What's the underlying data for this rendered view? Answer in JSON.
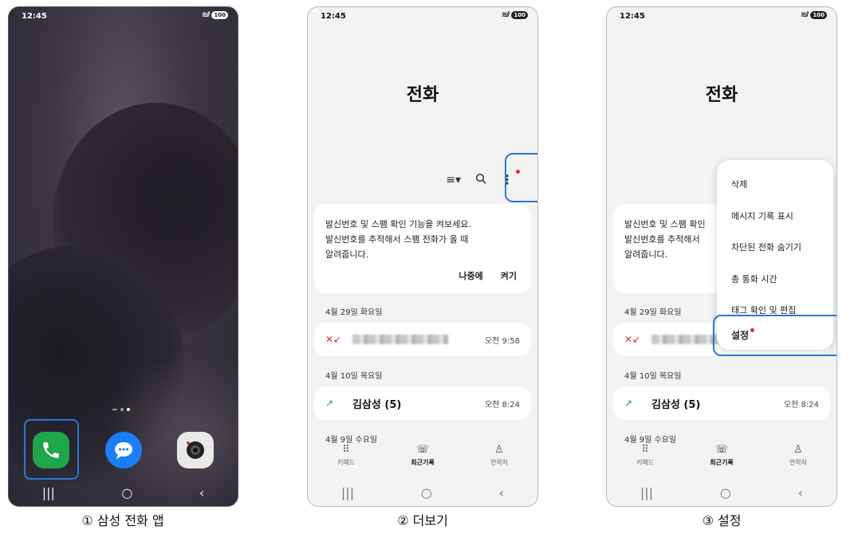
{
  "status": {
    "time": "12:45",
    "battery": "100"
  },
  "phone1": {
    "caption": "① 삼성 전화 앱"
  },
  "phone2": {
    "caption": "② 더보기",
    "title": "전화",
    "promo": {
      "line1": "발신번호 및 스팸 확인 기능을 켜보세요.",
      "line2": "발신번호를 추적해서 스팸 전화가 올 때",
      "line3": "알려줍니다.",
      "later": "나중에",
      "enable": "켜기"
    },
    "section1_date": "4월 29일 화요일",
    "call1_time": "오전 9:58",
    "section2_date": "4월 10일 목요일",
    "call2_name": "김삼성 (5)",
    "call2_time": "오전 8:24",
    "section3_date": "4월 9일 수요일"
  },
  "phone3": {
    "caption": "③ 설정",
    "title": "전화",
    "promo": {
      "line1": "발신번호 및 스팸 확인",
      "line2": "발신번호를 추적해서 ",
      "line3": "알려줍니다."
    },
    "menu": [
      "삭제",
      "메시지 기록 표시",
      "차단된 전화 숨기기",
      "총 통화 시간",
      "태그 확인 및 편집",
      "설정"
    ],
    "section1_date": "4월 29일 화요일",
    "section2_date": "4월 10일 목요일",
    "call2_name": "김삼성 (5)",
    "call2_time": "오전 8:24",
    "section3_date": "4월 9일 수요일"
  },
  "tabs": {
    "keypad": "키패드",
    "recents": "최근기록",
    "contacts": "연락처"
  },
  "nav_icons": {
    "recents": "|||",
    "home": "○",
    "back": "‹"
  }
}
